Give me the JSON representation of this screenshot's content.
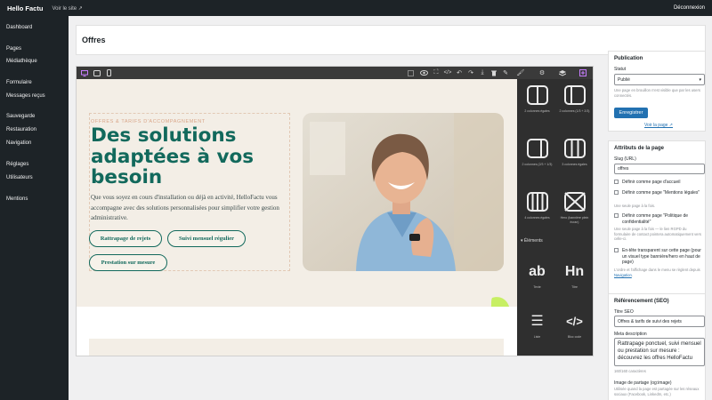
{
  "topbar": {
    "brand": "Hello Factu",
    "visit_link": "Voir le site ↗",
    "logout": "Déconnexion"
  },
  "sidebar": {
    "items": [
      {
        "label": "Dashboard"
      },
      {
        "label": "Pages"
      },
      {
        "label": "Médiathèque"
      },
      {
        "label": "Formulaire"
      },
      {
        "label": "Messages reçus"
      },
      {
        "label": "Sauvegarde"
      },
      {
        "label": "Restauration"
      },
      {
        "label": "Navigation"
      },
      {
        "label": "Réglages"
      },
      {
        "label": "Utilisateurs"
      },
      {
        "label": "Mentions"
      }
    ]
  },
  "page": {
    "title": "Offres"
  },
  "editor": {
    "toolbar_icons": [
      "desktop-icon",
      "tablet-icon",
      "mobile-icon",
      "select-icon",
      "eye-icon",
      "fullscreen-icon",
      "code-icon",
      "undo-icon",
      "redo-icon",
      "download-icon",
      "trash-icon",
      "pen-icon",
      "brush-icon",
      "gear-icon",
      "layers-icon",
      "add-block-icon"
    ],
    "hero": {
      "eyebrow": "OFFRES & TARIFS D'ACCOMPAGNEMENT",
      "title": "Des solutions adaptées à vos besoin",
      "text": "Que vous soyez en cours d'installation ou déjà en activité, HelloFactu vous accompagne avec des solutions personnalisées pour simplifier votre gestion administrative.",
      "buttons": [
        "Rattrapage de rejets",
        "Suivi mensuel régulier",
        "Prestation sur mesure"
      ]
    },
    "blocks": {
      "layout": [
        {
          "label": "2 colonnes égales",
          "icon": "two-columns-icon"
        },
        {
          "label": "2 colonnes (1/3 + 2/3)",
          "icon": "two-columns-third-icon"
        },
        {
          "label": "2 colonnes (2/3 + 1/3)",
          "icon": "two-columns-two-thirds-icon"
        },
        {
          "label": "3 colonnes égales",
          "icon": "three-columns-icon"
        },
        {
          "label": "4 colonnes égales",
          "icon": "four-columns-icon"
        },
        {
          "label": "Hero (bannière plein écran)",
          "icon": "hero-banner-icon"
        }
      ],
      "elements_label": "Éléments",
      "elements": [
        {
          "label": "Texte",
          "glyph": "ab"
        },
        {
          "label": "Titre",
          "glyph": "Hn"
        },
        {
          "label": "Liste",
          "glyph": "☰"
        },
        {
          "label": "Bloc code",
          "glyph": "</>"
        }
      ]
    }
  },
  "publication": {
    "heading": "Publication",
    "status_label": "Statut",
    "status_value": "Publié",
    "status_help": "Une page en brouillon n'est visible que par les users connectés.",
    "save_button": "Enregistrer",
    "view_link": "Voir la page ↗"
  },
  "attributes": {
    "heading": "Attributs de la page",
    "slug_label": "Slug (URL)",
    "slug_value": "offres",
    "home_checkbox": "Définir comme page d'accueil",
    "legal_checkbox": "Définir comme page \"Mentions légales\"",
    "legal_help": "Une seule page à la fois.",
    "privacy_checkbox": "Définir comme page \"Politique de confidentialité\"",
    "privacy_help": "Une seule page à la fois — le lien RGPD du formulaire de contact pointera automatiquement vers celle-ci.",
    "transparent_checkbox": "En-tête transparent sur cette page (pour un visuel type bannière/hero en haut de page)",
    "nav_help_prefix": "L'ordre et l'affichage dans le menu se règlent depuis",
    "nav_help_link": "Navigation"
  },
  "seo": {
    "heading": "Référencement (SEO)",
    "title_label": "Titre SEO",
    "title_value": "Offres & tarifs de suivi des rejets",
    "meta_label": "Meta description",
    "meta_value": "Rattrapage ponctuel, suivi mensuel ou prestation sur mesure : découvrez les offres HelloFactu",
    "meta_count": "160/160 caractères",
    "og_label": "Image de partage (og:image)",
    "og_help": "Utilisée quand la page est partagée sur les réseaux sociaux (Facebook, LinkedIn, etc.)"
  },
  "colors": {
    "admin_dark": "#1d2327",
    "brand_teal": "#12695c",
    "accent_lime": "#c7ef63",
    "wp_blue": "#2271b1"
  }
}
